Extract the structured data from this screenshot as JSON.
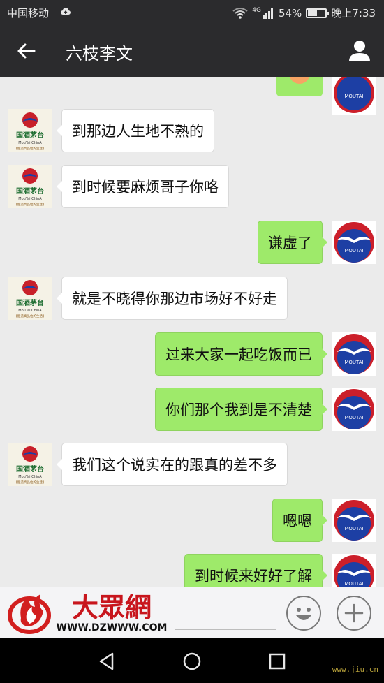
{
  "status_bar": {
    "carrier": "中国移动",
    "network": "4G",
    "battery": "54%",
    "battery_level": 0.54,
    "time": "晚上7:33"
  },
  "header": {
    "title": "六枝李文"
  },
  "logo_text": {
    "brand": "国酒茅台",
    "sub": "MouTai ChinA",
    "tag": "【酿造高品位的生活】",
    "moutai": "MOUTAI"
  },
  "messages": [
    {
      "side": "in",
      "text": "到那边人生地不熟的"
    },
    {
      "side": "in",
      "text": "到时候要麻烦哥子你咯"
    },
    {
      "side": "out",
      "text": "谦虚了"
    },
    {
      "side": "in",
      "text": "就是不晓得你那边市场好不好走"
    },
    {
      "side": "out",
      "text": "过来大家一起吃饭而已"
    },
    {
      "side": "out",
      "text": "你们那个我到是不清楚"
    },
    {
      "side": "in",
      "text": "我们这个说实在的跟真的差不多"
    },
    {
      "side": "out",
      "text": "嗯嗯"
    },
    {
      "side": "out",
      "text": "到时候来好好了解"
    }
  ],
  "watermark_logo": {
    "text": "大眾網",
    "url": "WWW.DZWWW.COM"
  },
  "watermark_corner": "www.jiu.cn",
  "colors": {
    "bar": "#2b2b2d",
    "bubble_out": "#9eea6a",
    "bubble_in": "#ffffff",
    "background": "#ebebeb"
  },
  "icons": {
    "back": "arrow-left-icon",
    "profile": "person-icon",
    "emoji": "smiley-icon",
    "plus": "plus-icon",
    "nav_back": "triangle-back-icon",
    "nav_home": "circle-home-icon",
    "nav_recent": "square-recent-icon"
  }
}
